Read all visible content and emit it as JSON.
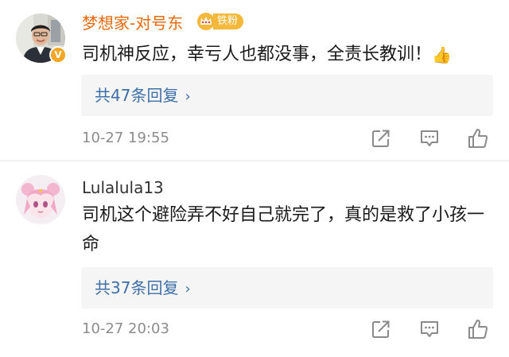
{
  "comments": [
    {
      "username": "梦想家-对号东",
      "fan_badge": "铁粉",
      "verified": true,
      "text": "司机神反应，幸亏人也都没事，全责长教训！",
      "emoji": "👍",
      "replies_label": "共47条回复",
      "chevron": "›",
      "timestamp": "10-27 19:55"
    },
    {
      "username": "Lulalula13",
      "text": "司机这个避险弄不好自己就完了，真的是救了小孩一命",
      "replies_label": "共37条回复",
      "chevron": "›",
      "timestamp": "10-27 20:03"
    }
  ],
  "colors": {
    "username_highlight": "#e8690c",
    "reply_link": "#3d6fa8",
    "reply_bg": "#f5f5f5",
    "fan_badge": "#f5b83a",
    "timestamp": "#8c8c8c"
  },
  "icons": {
    "share": "share-icon",
    "comment": "comment-icon",
    "like": "thumbs-up-icon",
    "verified": "verified-badge-icon",
    "crown": "crown-icon"
  }
}
